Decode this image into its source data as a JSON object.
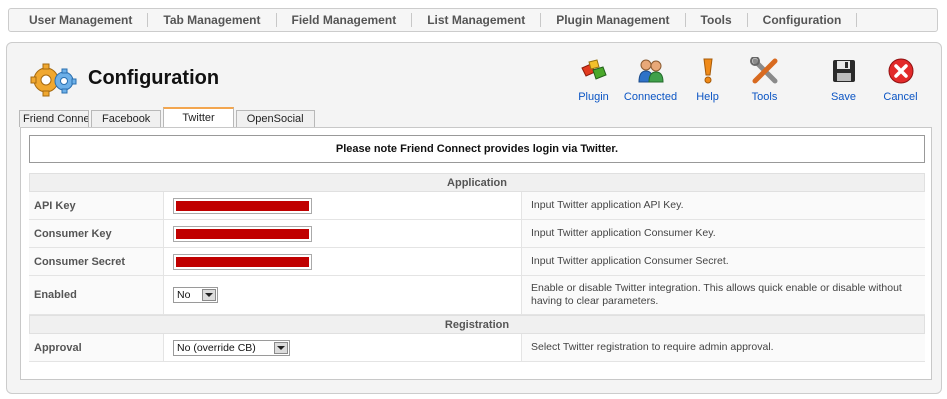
{
  "topnav": {
    "items": [
      {
        "label": "User Management"
      },
      {
        "label": "Tab Management"
      },
      {
        "label": "Field Management"
      },
      {
        "label": "List Management"
      },
      {
        "label": "Plugin Management"
      },
      {
        "label": "Tools"
      },
      {
        "label": "Configuration"
      }
    ]
  },
  "page": {
    "title": "Configuration",
    "title_icon": "gears-icon"
  },
  "toolbar": {
    "plugin": {
      "label": "Plugin",
      "icon": "plugin-icon"
    },
    "connected": {
      "label": "Connected",
      "icon": "users-icon"
    },
    "help": {
      "label": "Help",
      "icon": "exclamation-icon"
    },
    "tools": {
      "label": "Tools",
      "icon": "tools-icon"
    },
    "save": {
      "label": "Save",
      "icon": "floppy-disk-icon"
    },
    "cancel": {
      "label": "Cancel",
      "icon": "cancel-icon"
    }
  },
  "tabs": [
    {
      "label": "Friend Connect"
    },
    {
      "label": "Facebook"
    },
    {
      "label": "Twitter",
      "active": true
    },
    {
      "label": "OpenSocial"
    }
  ],
  "notice": "Please note Friend Connect provides login via Twitter.",
  "sections": {
    "application": "Application",
    "registration": "Registration"
  },
  "fields": {
    "api_key": {
      "label": "API Key",
      "desc": "Input Twitter application API Key."
    },
    "consumer_key": {
      "label": "Consumer Key",
      "desc": "Input Twitter application Consumer Key."
    },
    "consumer_secret": {
      "label": "Consumer Secret",
      "desc": "Input Twitter application Consumer Secret."
    },
    "enabled": {
      "label": "Enabled",
      "value": "No",
      "desc": "Enable or disable Twitter integration. This allows quick enable or disable without having to clear parameters."
    },
    "approval": {
      "label": "Approval",
      "value": "No (override CB)",
      "desc": "Select Twitter registration to require admin approval."
    }
  },
  "colors": {
    "redacted": "#c00000",
    "link": "#0b55c4",
    "active_tab": "#f3a64f"
  }
}
